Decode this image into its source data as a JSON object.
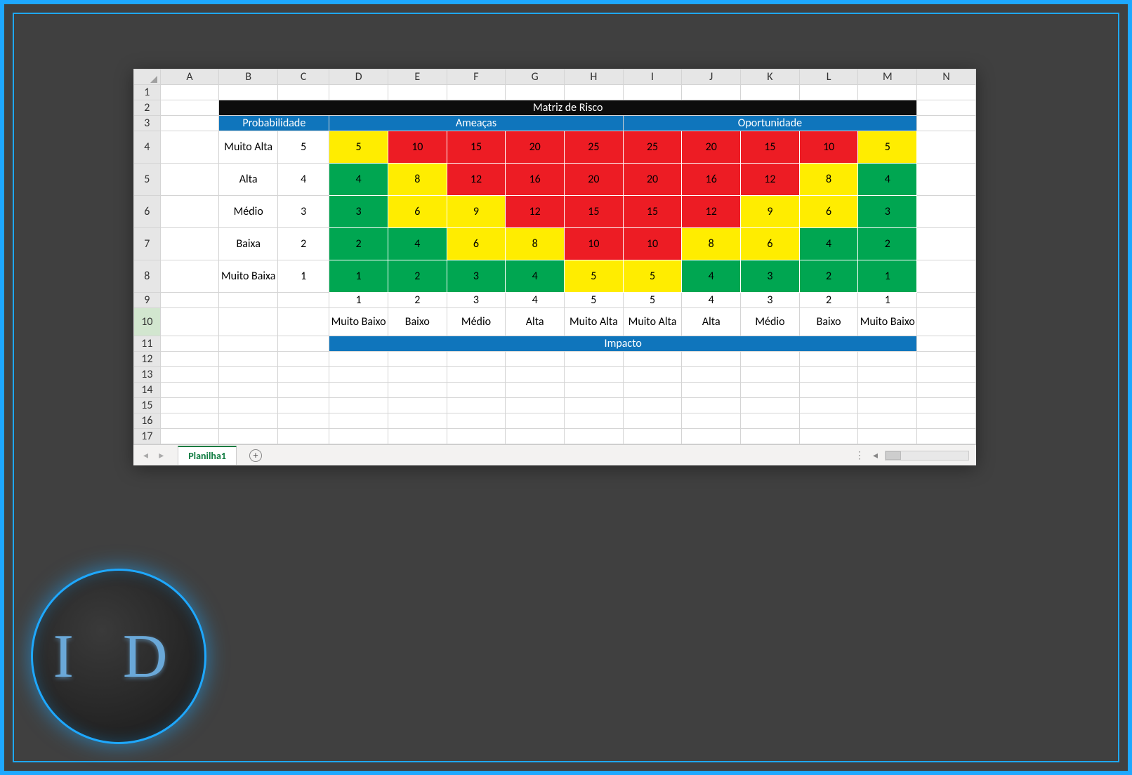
{
  "sheet_tab": "Planilha1",
  "columns": [
    "A",
    "B",
    "C",
    "D",
    "E",
    "F",
    "G",
    "H",
    "I",
    "J",
    "K",
    "L",
    "M",
    "N"
  ],
  "rows_visible": 17,
  "selected_row": 10,
  "logo_text": "I D",
  "chart_data": {
    "type": "table",
    "title": "Matriz de Risco",
    "sections": {
      "probability_header": "Probabilidade",
      "threats_header": "Ameaças",
      "opportunity_header": "Oportunidade",
      "impact_header": "Impacto"
    },
    "probability": [
      {
        "label": "Muito Alta",
        "value": 5
      },
      {
        "label": "Alta",
        "value": 4
      },
      {
        "label": "Médio",
        "value": 3
      },
      {
        "label": "Baixa",
        "value": 2
      },
      {
        "label": "Muito Baixa",
        "value": 1
      }
    ],
    "impact_values": [
      1,
      2,
      3,
      4,
      5,
      5,
      4,
      3,
      2,
      1
    ],
    "impact_labels": [
      "Muito Baixo",
      "Baixo",
      "Médio",
      "Alta",
      "Muito Alta",
      "Muito Alta",
      "Alta",
      "Médio",
      "Baixo",
      "Muito Baixo"
    ],
    "matrix": [
      [
        {
          "v": 5,
          "c": "y"
        },
        {
          "v": 10,
          "c": "r"
        },
        {
          "v": 15,
          "c": "r"
        },
        {
          "v": 20,
          "c": "r"
        },
        {
          "v": 25,
          "c": "r"
        },
        {
          "v": 25,
          "c": "r"
        },
        {
          "v": 20,
          "c": "r"
        },
        {
          "v": 15,
          "c": "r"
        },
        {
          "v": 10,
          "c": "r"
        },
        {
          "v": 5,
          "c": "y"
        }
      ],
      [
        {
          "v": 4,
          "c": "g"
        },
        {
          "v": 8,
          "c": "y"
        },
        {
          "v": 12,
          "c": "r"
        },
        {
          "v": 16,
          "c": "r"
        },
        {
          "v": 20,
          "c": "r"
        },
        {
          "v": 20,
          "c": "r"
        },
        {
          "v": 16,
          "c": "r"
        },
        {
          "v": 12,
          "c": "r"
        },
        {
          "v": 8,
          "c": "y"
        },
        {
          "v": 4,
          "c": "g"
        }
      ],
      [
        {
          "v": 3,
          "c": "g"
        },
        {
          "v": 6,
          "c": "y"
        },
        {
          "v": 9,
          "c": "y"
        },
        {
          "v": 12,
          "c": "r"
        },
        {
          "v": 15,
          "c": "r"
        },
        {
          "v": 15,
          "c": "r"
        },
        {
          "v": 12,
          "c": "r"
        },
        {
          "v": 9,
          "c": "y"
        },
        {
          "v": 6,
          "c": "y"
        },
        {
          "v": 3,
          "c": "g"
        }
      ],
      [
        {
          "v": 2,
          "c": "g"
        },
        {
          "v": 4,
          "c": "g"
        },
        {
          "v": 6,
          "c": "y"
        },
        {
          "v": 8,
          "c": "y"
        },
        {
          "v": 10,
          "c": "r"
        },
        {
          "v": 10,
          "c": "r"
        },
        {
          "v": 8,
          "c": "y"
        },
        {
          "v": 6,
          "c": "y"
        },
        {
          "v": 4,
          "c": "g"
        },
        {
          "v": 2,
          "c": "g"
        }
      ],
      [
        {
          "v": 1,
          "c": "g"
        },
        {
          "v": 2,
          "c": "g"
        },
        {
          "v": 3,
          "c": "g"
        },
        {
          "v": 4,
          "c": "g"
        },
        {
          "v": 5,
          "c": "y"
        },
        {
          "v": 5,
          "c": "y"
        },
        {
          "v": 4,
          "c": "g"
        },
        {
          "v": 3,
          "c": "g"
        },
        {
          "v": 2,
          "c": "g"
        },
        {
          "v": 1,
          "c": "g"
        }
      ]
    ]
  }
}
